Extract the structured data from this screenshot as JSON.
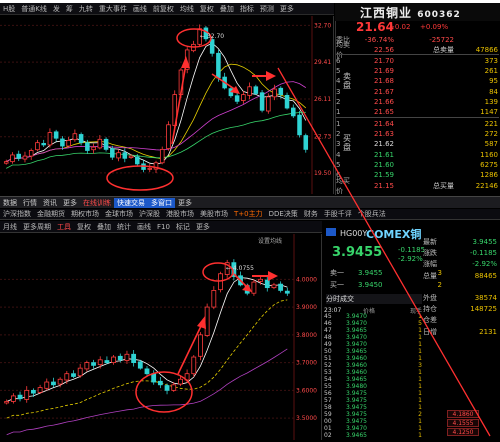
{
  "top": {
    "toolbar": [
      "H股",
      "普通K线",
      "发",
      "筹",
      "九转",
      "重大事件",
      "画线",
      "前复权",
      "均线",
      "复权",
      "叠加",
      "指标",
      "预测",
      "更多"
    ],
    "price_axis": [
      "32.70",
      "29.41",
      "26.11",
      "22.73",
      "19.50"
    ],
    "annotations": {
      "high": "32.70"
    }
  },
  "stock": {
    "name": "江西铜业",
    "code": "600362",
    "price": "21.64",
    "change": "+0.02",
    "pct": "+0.09%",
    "summary_rows": [
      {
        "label": "委比",
        "v1": "-36.74%",
        "v2": "-25722",
        "v3": ""
      },
      {
        "label": "均卖价",
        "v1": "22.56",
        "v2": "总卖量",
        "v3": "47866"
      }
    ],
    "sell_rows": [
      {
        "n": "6",
        "p": "21.70",
        "v": "373"
      },
      {
        "n": "5",
        "p": "21.69",
        "v": "261"
      },
      {
        "n": "4",
        "p": "21.68",
        "v": "95"
      },
      {
        "n": "3",
        "p": "21.67",
        "v": "84"
      },
      {
        "n": "2",
        "p": "21.66",
        "v": "139"
      },
      {
        "n": "1",
        "p": "21.65",
        "v": "1147"
      }
    ],
    "buy_rows": [
      {
        "n": "1",
        "p": "21.64",
        "v": "221"
      },
      {
        "n": "2",
        "p": "21.63",
        "v": "272"
      },
      {
        "n": "3",
        "p": "21.62",
        "v": "587"
      },
      {
        "n": "4",
        "p": "21.61",
        "v": "1160"
      },
      {
        "n": "5",
        "p": "21.60",
        "v": "6275"
      },
      {
        "n": "6",
        "p": "21.59",
        "v": "1286"
      }
    ],
    "bottom_row": {
      "label": "均买价",
      "v1": "21.15",
      "v2": "总买量",
      "v3": "22146"
    },
    "sell_label": "卖盘",
    "buy_label": "买盘"
  },
  "toolbar2": [
    "数据",
    "行情",
    "资讯",
    "更多",
    "在线训练",
    "快速交易",
    "多窗口",
    "更多"
  ],
  "toolbar3": [
    "沪深指数",
    "金融期货",
    "期权市场",
    "金球市场",
    "沪深股",
    "港股市场",
    "美股市场",
    "T+0主力",
    "DDE决策",
    "财务",
    "手股千评",
    "个股兵法"
  ],
  "toolbar4": [
    "月线",
    "更多周期",
    "工具",
    "复权",
    "叠加",
    "统计",
    "画线",
    "F10",
    "标记",
    "更多"
  ],
  "bottom": {
    "settings_label": "设置均线",
    "price_axis": [
      "4.0000",
      "3.9000",
      "3.8000",
      "3.7000",
      "3.6000",
      "3.5000"
    ],
    "annotations": {
      "high": "4.0755"
    }
  },
  "comex": {
    "code": "HG00Y",
    "name": "COMEX铜",
    "price": "3.9455",
    "change": "-0.1185",
    "pct": "-2.92%",
    "sell1": {
      "label": "卖一",
      "price": "3.9455",
      "vol": "3"
    },
    "buy1": {
      "label": "买一",
      "price": "3.9450",
      "vol": "2"
    },
    "ticker_header": [
      "分时成交",
      "时间",
      "价格",
      "现手"
    ],
    "ticker_time": "23:07",
    "ticker": [
      [
        "45",
        "3.9470",
        "1"
      ],
      [
        "46",
        "3.9470",
        "5"
      ],
      [
        "47",
        "3.9465",
        "1"
      ],
      [
        "48",
        "3.9470",
        "1"
      ],
      [
        "49",
        "3.9470",
        "1"
      ],
      [
        "50",
        "3.9465",
        "1"
      ],
      [
        "51",
        "3.9460",
        "1"
      ],
      [
        "52",
        "3.9460",
        "3"
      ],
      [
        "53",
        "3.9460",
        "1"
      ],
      [
        "54",
        "3.9465",
        "1"
      ],
      [
        "55",
        "3.9480",
        "1"
      ],
      [
        "56",
        "3.9475",
        "1"
      ],
      [
        "57",
        "3.9475",
        "1"
      ],
      [
        "58",
        "3.9475",
        "1"
      ],
      [
        "59",
        "3.9475",
        "2"
      ],
      [
        "00",
        "3.9475",
        "1"
      ],
      [
        "01",
        "3.9470",
        "1"
      ],
      [
        "02",
        "3.9465",
        "1"
      ]
    ],
    "right_rows": [
      {
        "a": "最新",
        "b": "3.9455"
      },
      {
        "a": "涨跌",
        "b": "-0.1185"
      },
      {
        "a": "涨幅",
        "b": "-2.92%"
      },
      {
        "a": "总量",
        "b": "88465"
      },
      {
        "a": "",
        "b": ""
      },
      {
        "a": "外盘",
        "b": "38574"
      },
      {
        "a": "持仓",
        "b": "148725"
      },
      {
        "a": "仓差",
        "b": ""
      },
      {
        "a": "日增",
        "b": "2131"
      }
    ],
    "price_tags": [
      "4.1860",
      "4.1555",
      "4.1250"
    ]
  },
  "chart_data": [
    {
      "type": "candlestick",
      "title": "江西铜业 600362",
      "y_ticks": [
        32.7,
        29.41,
        26.11,
        22.73,
        19.5
      ],
      "ylim": [
        18.5,
        33.0
      ],
      "close_approx": [
        20.5,
        21.1,
        20.8,
        21.0,
        21.5,
        22.2,
        22.0,
        23.1,
        22.6,
        21.9,
        22.4,
        23.0,
        22.2,
        21.5,
        21.8,
        22.5,
        21.6,
        20.9,
        21.3,
        20.8,
        21.0,
        20.3,
        19.8,
        19.9,
        20.4,
        21.6,
        23.8,
        26.5,
        28.7,
        30.5,
        31.0,
        32.4,
        31.5,
        30.2,
        28.0,
        27.1,
        26.4,
        25.9,
        26.5,
        27.2,
        26.6,
        25.1,
        26.3,
        27.0,
        26.5,
        25.3,
        24.6,
        22.9,
        21.6
      ]
    },
    {
      "type": "candlestick",
      "title": "COMEX铜 HG00Y",
      "y_ticks": [
        4.0,
        3.9,
        3.8,
        3.7,
        3.6,
        3.5
      ],
      "ylim": [
        3.45,
        4.12
      ],
      "close_approx": [
        3.56,
        3.58,
        3.57,
        3.6,
        3.59,
        3.61,
        3.63,
        3.62,
        3.64,
        3.66,
        3.65,
        3.68,
        3.7,
        3.69,
        3.71,
        3.7,
        3.72,
        3.71,
        3.73,
        3.7,
        3.68,
        3.66,
        3.63,
        3.62,
        3.6,
        3.62,
        3.64,
        3.66,
        3.72,
        3.8,
        3.9,
        3.96,
        4.02,
        4.06,
        4.01,
        3.98,
        3.95,
        3.99,
        4.0,
        3.97,
        3.98,
        3.96,
        3.95
      ]
    }
  ]
}
